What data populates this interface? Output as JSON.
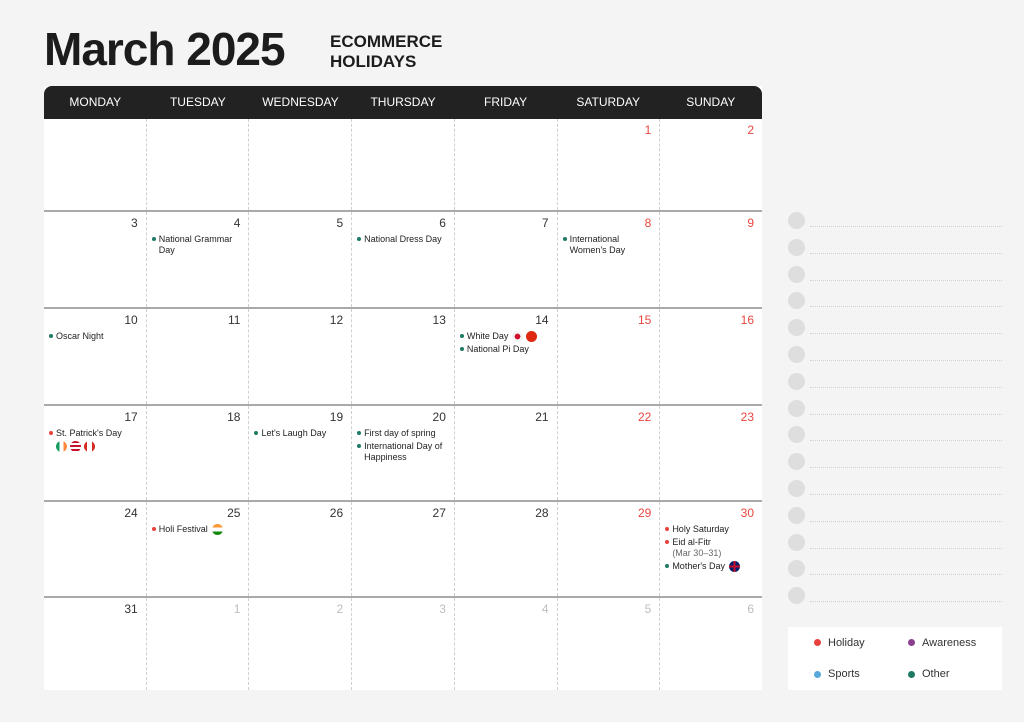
{
  "header": {
    "title": "March 2025",
    "subtitle_line1": "ECOMMERCE",
    "subtitle_line2": "HOLIDAYS"
  },
  "colors": {
    "holiday": "#e8403c",
    "awareness": "#8a3f8f",
    "sports": "#5aa7dc",
    "other": "#1e7a63",
    "weekend": "#e8473f",
    "header_bg": "#222222"
  },
  "weekdays": [
    "MONDAY",
    "TUESDAY",
    "WEDNESDAY",
    "THURSDAY",
    "FRIDAY",
    "SATURDAY",
    "SUNDAY"
  ],
  "weeks": [
    [
      {
        "num": ""
      },
      {
        "num": ""
      },
      {
        "num": ""
      },
      {
        "num": ""
      },
      {
        "num": ""
      },
      {
        "num": "1",
        "weekend": true
      },
      {
        "num": "2",
        "weekend": true
      }
    ],
    [
      {
        "num": "3"
      },
      {
        "num": "4",
        "events": [
          {
            "label": "National Grammar Day",
            "type": "other"
          }
        ]
      },
      {
        "num": "5"
      },
      {
        "num": "6",
        "events": [
          {
            "label": "National Dress Day",
            "type": "other"
          }
        ]
      },
      {
        "num": "7"
      },
      {
        "num": "8",
        "weekend": true,
        "events": [
          {
            "label": "International Women's Day",
            "type": "other"
          }
        ]
      },
      {
        "num": "9",
        "weekend": true
      }
    ],
    [
      {
        "num": "10",
        "events": [
          {
            "label": "Oscar Night",
            "type": "other"
          }
        ]
      },
      {
        "num": "11"
      },
      {
        "num": "12"
      },
      {
        "num": "13"
      },
      {
        "num": "14",
        "events": [
          {
            "label": "White Day",
            "type": "other",
            "flags": [
              "japan-flag",
              "china-flag"
            ]
          },
          {
            "label": "National Pi Day",
            "type": "other"
          }
        ]
      },
      {
        "num": "15",
        "weekend": true
      },
      {
        "num": "16",
        "weekend": true
      }
    ],
    [
      {
        "num": "17",
        "events": [
          {
            "label": "St. Patrick's Day",
            "type": "holiday",
            "flags_below": true,
            "flags": [
              "ireland-flag",
              "usa-flag",
              "canada-flag"
            ]
          }
        ]
      },
      {
        "num": "18"
      },
      {
        "num": "19",
        "events": [
          {
            "label": "Let's Laugh Day",
            "type": "other"
          }
        ]
      },
      {
        "num": "20",
        "events": [
          {
            "label": "First day of spring",
            "type": "other"
          },
          {
            "label": "International Day of Happiness",
            "type": "other"
          }
        ]
      },
      {
        "num": "21"
      },
      {
        "num": "22",
        "weekend": true
      },
      {
        "num": "23",
        "weekend": true
      }
    ],
    [
      {
        "num": "24"
      },
      {
        "num": "25",
        "events": [
          {
            "label": "Holi Festival",
            "type": "holiday",
            "flags": [
              "india-flag"
            ]
          }
        ]
      },
      {
        "num": "26"
      },
      {
        "num": "27"
      },
      {
        "num": "28"
      },
      {
        "num": "29",
        "weekend": true
      },
      {
        "num": "30",
        "weekend": true,
        "events": [
          {
            "label": "Holy Saturday",
            "type": "holiday"
          },
          {
            "label": "Eid al-Fitr",
            "sub": "(Mar 30–31)",
            "type": "holiday"
          },
          {
            "label": "Mother's Day",
            "type": "other",
            "flags": [
              "uk-flag"
            ]
          }
        ]
      }
    ],
    [
      {
        "num": "31"
      },
      {
        "num": "1",
        "muted": true
      },
      {
        "num": "2",
        "muted": true
      },
      {
        "num": "3",
        "muted": true
      },
      {
        "num": "4",
        "muted": true
      },
      {
        "num": "5",
        "muted": true
      },
      {
        "num": "6",
        "muted": true
      }
    ]
  ],
  "notes_count": 15,
  "legend": [
    {
      "label": "Holiday",
      "type": "holiday"
    },
    {
      "label": "Awareness",
      "type": "awareness"
    },
    {
      "label": "Sports",
      "type": "sports"
    },
    {
      "label": "Other",
      "type": "other"
    }
  ]
}
